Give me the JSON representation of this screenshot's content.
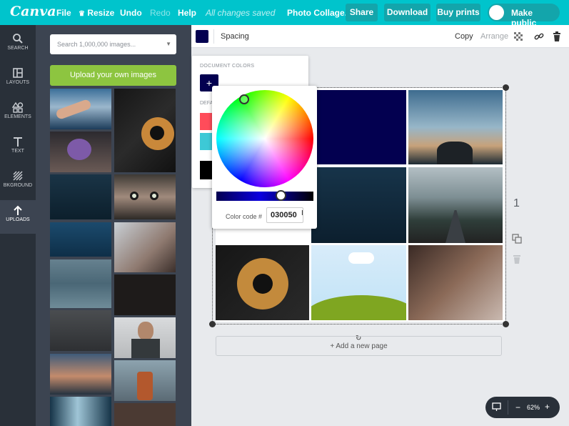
{
  "topbar": {
    "logo": "Canva",
    "file": "File",
    "resize": "Resize",
    "undo": "Undo",
    "redo": "Redo",
    "help": "Help",
    "saved": "All changes saved",
    "doc_title": "Photo Collage...",
    "share": "Share",
    "download": "Download",
    "buy_prints": "Buy prints",
    "make_public": "Make public"
  },
  "rail": {
    "items": [
      {
        "label": "SEARCH",
        "icon": "search-icon"
      },
      {
        "label": "LAYOUTS",
        "icon": "layouts-icon"
      },
      {
        "label": "ELEMENTS",
        "icon": "elements-icon"
      },
      {
        "label": "TEXT",
        "icon": "text-icon"
      },
      {
        "label": "BKGROUND",
        "icon": "background-icon"
      },
      {
        "label": "UPLOADS",
        "icon": "upload-icon",
        "active": true
      }
    ]
  },
  "panel": {
    "search_placeholder": "Search 1,000,000 images...",
    "upload_button": "Upload your own images"
  },
  "toolbar": {
    "spacing": "Spacing",
    "copy": "Copy",
    "arrange": "Arrange",
    "swatch_color": "#030050"
  },
  "color_menu": {
    "document_colors": "DOCUMENT COLORS",
    "default_prefix": "DEFA",
    "add": "+"
  },
  "picker": {
    "label": "Color code #",
    "value": "030050"
  },
  "canvas": {
    "add_page": "+ Add a new page",
    "page_number": "1",
    "zoom": "62%",
    "zoom_minus": "−",
    "zoom_plus": "+"
  },
  "colors": {
    "brand": "#00c4cc",
    "selected": "#030050"
  }
}
